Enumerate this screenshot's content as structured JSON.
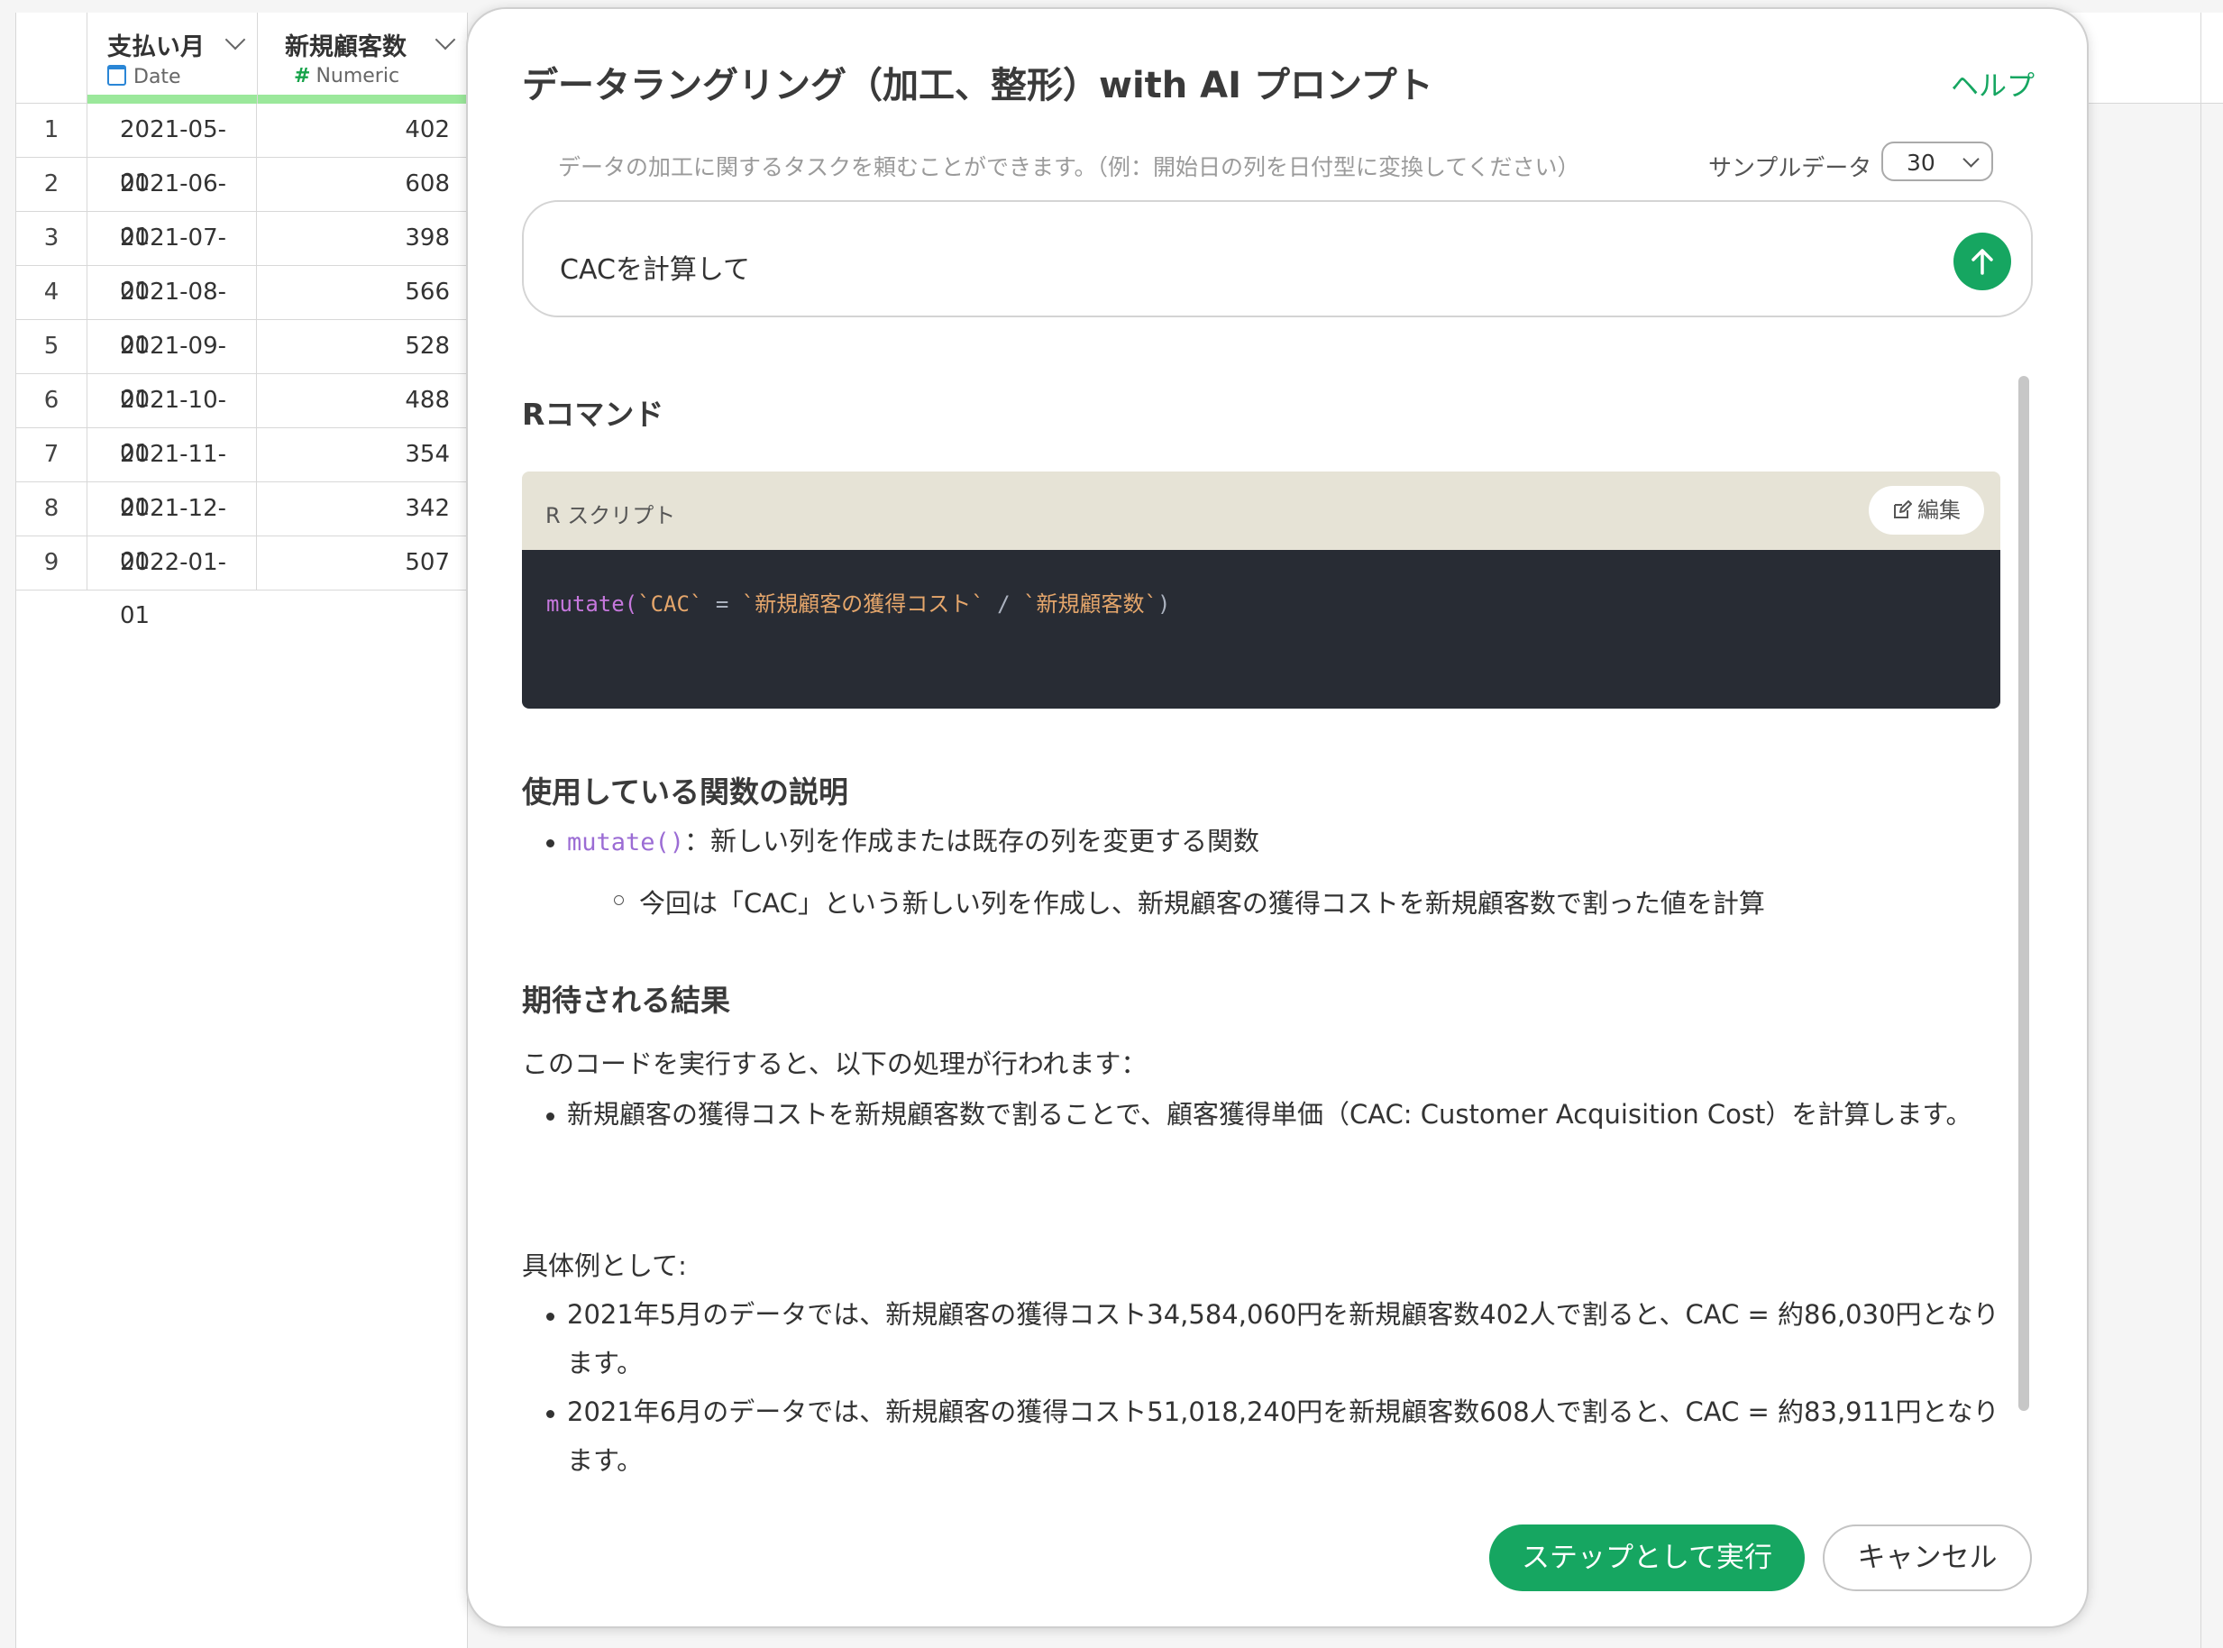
{
  "table": {
    "columns": [
      {
        "name": "支払い月",
        "type": "Date",
        "type_icon": "calendar-icon"
      },
      {
        "name": "新規顧客数",
        "type": "Numeric",
        "type_icon": "hash-icon"
      }
    ],
    "rows": [
      {
        "n": "1",
        "date": "2021-05-01",
        "value": "402"
      },
      {
        "n": "2",
        "date": "2021-06-01",
        "value": "608"
      },
      {
        "n": "3",
        "date": "2021-07-01",
        "value": "398"
      },
      {
        "n": "4",
        "date": "2021-08-01",
        "value": "566"
      },
      {
        "n": "5",
        "date": "2021-09-01",
        "value": "528"
      },
      {
        "n": "6",
        "date": "2021-10-01",
        "value": "488"
      },
      {
        "n": "7",
        "date": "2021-11-01",
        "value": "354"
      },
      {
        "n": "8",
        "date": "2021-12-01",
        "value": "342"
      },
      {
        "n": "9",
        "date": "2022-01-01",
        "value": "507"
      }
    ]
  },
  "modal": {
    "title": "データラングリング（加工、整形）with AI プロンプト",
    "help": "ヘルプ",
    "hint": "データの加工に関するタスクを頼むことができます。（例：開始日の列を日付型に変換してください）",
    "sample_label": "サンプルデータ",
    "sample_value": "30",
    "prompt": "CACを計算して",
    "r_command_heading": "Rコマンド",
    "script_label": "R スクリプト",
    "edit_label": "編集",
    "code": {
      "fn": "mutate(",
      "col": "`CAC`",
      "op1": " = ",
      "src": "`新規顧客の獲得コスト`",
      "op2": " / ",
      "den": "`新規顧客数`",
      "close": ")"
    },
    "functions_heading": "使用している関数の説明",
    "func_name": "mutate()",
    "func_desc": "：新しい列を作成または既存の列を変更する関数",
    "func_sub": "今回は「CAC」という新しい列を作成し、新規顧客の獲得コストを新規顧客数で割った値を計算",
    "expected_heading": "期待される結果",
    "expected_intro": "このコードを実行すると、以下の処理が行われます：",
    "expected_bullet": "新規顧客の獲得コストを新規顧客数で割ることで、顧客獲得単価（CAC: Customer Acquisition Cost）を計算します。",
    "example_intro": "具体例として:",
    "examples": [
      "2021年5月のデータでは、新規顧客の獲得コスト34,584,060円を新規顧客数402人で割ると、CAC = 約86,030円となります。",
      "2021年6月のデータでは、新規顧客の獲得コスト51,018,240円を新規顧客数608人で割ると、CAC = 約83,911円となります。"
    ],
    "run_button": "ステップとして実行",
    "cancel_button": "キャンセル"
  },
  "colors": {
    "accent": "#16a661",
    "code_bg": "#282c34",
    "code_header": "#e6e3d6"
  }
}
